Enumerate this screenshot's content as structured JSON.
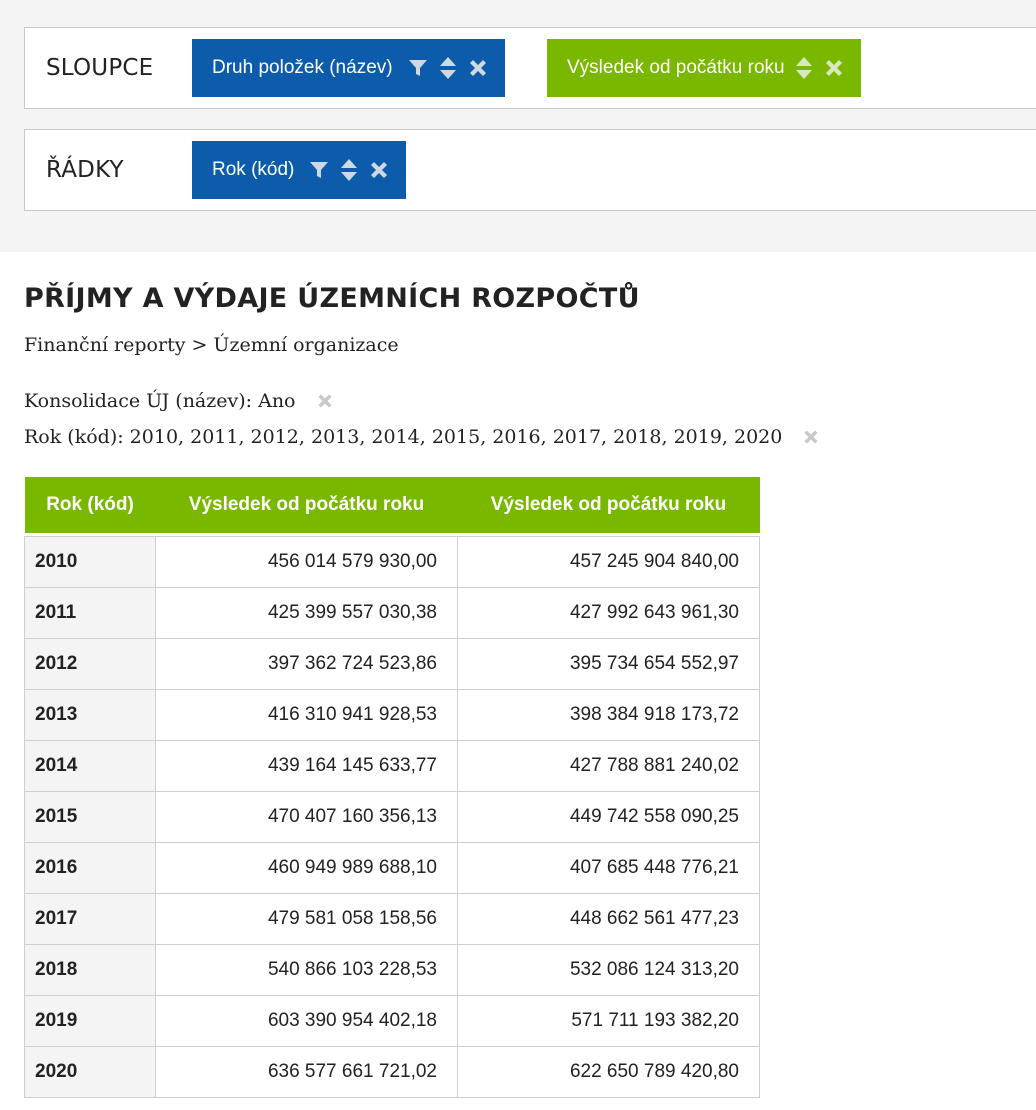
{
  "config": {
    "columns_label": "SLOUPCE",
    "rows_label": "ŘÁDKY",
    "column_chips": [
      {
        "label": "Druh položek (název)",
        "color": "#0d5cac"
      },
      {
        "label": "Výsledek od počátku roku",
        "color": "#7ab800"
      }
    ],
    "row_chips": [
      {
        "label": "Rok (kód)",
        "color": "#0d5cac"
      }
    ]
  },
  "report": {
    "title": "PŘÍJMY A VÝDAJE ÚZEMNÍCH ROZPOČTŮ",
    "breadcrumb": "Finanční reporty > Územní organizace",
    "filters": [
      "Konsolidace ÚJ (název): Ano",
      "Rok (kód): 2010, 2011, 2012, 2013, 2014, 2015, 2016, 2017, 2018, 2019, 2020"
    ]
  },
  "table": {
    "headers": [
      "Rok (kód)",
      "Výsledek od počátku roku",
      "Výsledek od počátku roku"
    ],
    "rows": [
      [
        "2010",
        "456 014 579 930,00",
        "457 245 904 840,00"
      ],
      [
        "2011",
        "425 399 557 030,38",
        "427 992 643 961,30"
      ],
      [
        "2012",
        "397 362 724 523,86",
        "395 734 654 552,97"
      ],
      [
        "2013",
        "416 310 941 928,53",
        "398 384 918 173,72"
      ],
      [
        "2014",
        "439 164 145 633,77",
        "427 788 881 240,02"
      ],
      [
        "2015",
        "470 407 160 356,13",
        "449 742 558 090,25"
      ],
      [
        "2016",
        "460 949 989 688,10",
        "407 685 448 776,21"
      ],
      [
        "2017",
        "479 581 058 158,56",
        "448 662 561 477,23"
      ],
      [
        "2018",
        "540 866 103 228,53",
        "532 086 124 313,20"
      ],
      [
        "2019",
        "603 390 954 402,18",
        "571 711 193 382,20"
      ],
      [
        "2020",
        "636 577 661 721,02",
        "622 650 789 420,80"
      ]
    ]
  },
  "colors": {
    "blue_chip": "#0d5cac",
    "green_accent": "#7ab800",
    "panel_bg": "#f4f4f4"
  }
}
